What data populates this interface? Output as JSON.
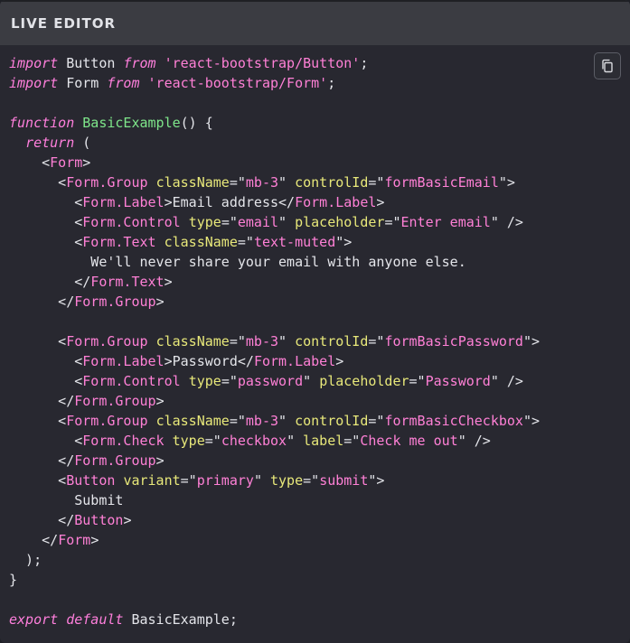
{
  "header": {
    "title": "LIVE EDITOR"
  },
  "toolbar": {
    "copy_icon": "copy-icon"
  },
  "colors": {
    "background": "#282830",
    "header_bg": "#3b3c42",
    "keyword": "#ff7fdc",
    "tag": "#ff80d6",
    "function_name": "#7ee68a",
    "attribute": "#e8e87a",
    "text": "#e4e5ea"
  },
  "code": {
    "lines": [
      [
        {
          "t": "import",
          "c": "k"
        },
        {
          "t": " Button ",
          "c": ""
        },
        {
          "t": "from",
          "c": "k"
        },
        {
          "t": " ",
          "c": ""
        },
        {
          "t": "'react-bootstrap/Button'",
          "c": "s"
        },
        {
          "t": ";",
          "c": ""
        }
      ],
      [
        {
          "t": "import",
          "c": "k"
        },
        {
          "t": " Form ",
          "c": ""
        },
        {
          "t": "from",
          "c": "k"
        },
        {
          "t": " ",
          "c": ""
        },
        {
          "t": "'react-bootstrap/Form'",
          "c": "s"
        },
        {
          "t": ";",
          "c": ""
        }
      ],
      [],
      [
        {
          "t": "function",
          "c": "k"
        },
        {
          "t": " ",
          "c": ""
        },
        {
          "t": "BasicExample",
          "c": "fn"
        },
        {
          "t": "() {",
          "c": ""
        }
      ],
      [
        {
          "t": "  ",
          "c": ""
        },
        {
          "t": "return",
          "c": "k"
        },
        {
          "t": " (",
          "c": ""
        }
      ],
      [
        {
          "t": "    <",
          "c": ""
        },
        {
          "t": "Form",
          "c": "t"
        },
        {
          "t": ">",
          "c": ""
        }
      ],
      [
        {
          "t": "      <",
          "c": ""
        },
        {
          "t": "Form.Group",
          "c": "t"
        },
        {
          "t": " ",
          "c": ""
        },
        {
          "t": "className",
          "c": "a"
        },
        {
          "t": "=\"",
          "c": ""
        },
        {
          "t": "mb-3",
          "c": "s"
        },
        {
          "t": "\" ",
          "c": ""
        },
        {
          "t": "controlId",
          "c": "a"
        },
        {
          "t": "=\"",
          "c": ""
        },
        {
          "t": "formBasicEmail",
          "c": "s"
        },
        {
          "t": "\">",
          "c": ""
        }
      ],
      [
        {
          "t": "        <",
          "c": ""
        },
        {
          "t": "Form.Label",
          "c": "t"
        },
        {
          "t": ">Email address</",
          "c": ""
        },
        {
          "t": "Form.Label",
          "c": "t"
        },
        {
          "t": ">",
          "c": ""
        }
      ],
      [
        {
          "t": "        <",
          "c": ""
        },
        {
          "t": "Form.Control",
          "c": "t"
        },
        {
          "t": " ",
          "c": ""
        },
        {
          "t": "type",
          "c": "a"
        },
        {
          "t": "=\"",
          "c": ""
        },
        {
          "t": "email",
          "c": "s"
        },
        {
          "t": "\" ",
          "c": ""
        },
        {
          "t": "placeholder",
          "c": "a"
        },
        {
          "t": "=\"",
          "c": ""
        },
        {
          "t": "Enter email",
          "c": "s"
        },
        {
          "t": "\" />",
          "c": ""
        }
      ],
      [
        {
          "t": "        <",
          "c": ""
        },
        {
          "t": "Form.Text",
          "c": "t"
        },
        {
          "t": " ",
          "c": ""
        },
        {
          "t": "className",
          "c": "a"
        },
        {
          "t": "=\"",
          "c": ""
        },
        {
          "t": "text-muted",
          "c": "s"
        },
        {
          "t": "\">",
          "c": ""
        }
      ],
      [
        {
          "t": "          We'll never share your email with anyone else.",
          "c": ""
        }
      ],
      [
        {
          "t": "        </",
          "c": ""
        },
        {
          "t": "Form.Text",
          "c": "t"
        },
        {
          "t": ">",
          "c": ""
        }
      ],
      [
        {
          "t": "      </",
          "c": ""
        },
        {
          "t": "Form.Group",
          "c": "t"
        },
        {
          "t": ">",
          "c": ""
        }
      ],
      [],
      [
        {
          "t": "      <",
          "c": ""
        },
        {
          "t": "Form.Group",
          "c": "t"
        },
        {
          "t": " ",
          "c": ""
        },
        {
          "t": "className",
          "c": "a"
        },
        {
          "t": "=\"",
          "c": ""
        },
        {
          "t": "mb-3",
          "c": "s"
        },
        {
          "t": "\" ",
          "c": ""
        },
        {
          "t": "controlId",
          "c": "a"
        },
        {
          "t": "=\"",
          "c": ""
        },
        {
          "t": "formBasicPassword",
          "c": "s"
        },
        {
          "t": "\">",
          "c": ""
        }
      ],
      [
        {
          "t": "        <",
          "c": ""
        },
        {
          "t": "Form.Label",
          "c": "t"
        },
        {
          "t": ">Password</",
          "c": ""
        },
        {
          "t": "Form.Label",
          "c": "t"
        },
        {
          "t": ">",
          "c": ""
        }
      ],
      [
        {
          "t": "        <",
          "c": ""
        },
        {
          "t": "Form.Control",
          "c": "t"
        },
        {
          "t": " ",
          "c": ""
        },
        {
          "t": "type",
          "c": "a"
        },
        {
          "t": "=\"",
          "c": ""
        },
        {
          "t": "password",
          "c": "s"
        },
        {
          "t": "\" ",
          "c": ""
        },
        {
          "t": "placeholder",
          "c": "a"
        },
        {
          "t": "=\"",
          "c": ""
        },
        {
          "t": "Password",
          "c": "s"
        },
        {
          "t": "\" />",
          "c": ""
        }
      ],
      [
        {
          "t": "      </",
          "c": ""
        },
        {
          "t": "Form.Group",
          "c": "t"
        },
        {
          "t": ">",
          "c": ""
        }
      ],
      [
        {
          "t": "      <",
          "c": ""
        },
        {
          "t": "Form.Group",
          "c": "t"
        },
        {
          "t": " ",
          "c": ""
        },
        {
          "t": "className",
          "c": "a"
        },
        {
          "t": "=\"",
          "c": ""
        },
        {
          "t": "mb-3",
          "c": "s"
        },
        {
          "t": "\" ",
          "c": ""
        },
        {
          "t": "controlId",
          "c": "a"
        },
        {
          "t": "=\"",
          "c": ""
        },
        {
          "t": "formBasicCheckbox",
          "c": "s"
        },
        {
          "t": "\">",
          "c": ""
        }
      ],
      [
        {
          "t": "        <",
          "c": ""
        },
        {
          "t": "Form.Check",
          "c": "t"
        },
        {
          "t": " ",
          "c": ""
        },
        {
          "t": "type",
          "c": "a"
        },
        {
          "t": "=\"",
          "c": ""
        },
        {
          "t": "checkbox",
          "c": "s"
        },
        {
          "t": "\" ",
          "c": ""
        },
        {
          "t": "label",
          "c": "a"
        },
        {
          "t": "=\"",
          "c": ""
        },
        {
          "t": "Check me out",
          "c": "s"
        },
        {
          "t": "\" />",
          "c": ""
        }
      ],
      [
        {
          "t": "      </",
          "c": ""
        },
        {
          "t": "Form.Group",
          "c": "t"
        },
        {
          "t": ">",
          "c": ""
        }
      ],
      [
        {
          "t": "      <",
          "c": ""
        },
        {
          "t": "Button",
          "c": "t"
        },
        {
          "t": " ",
          "c": ""
        },
        {
          "t": "variant",
          "c": "a"
        },
        {
          "t": "=\"",
          "c": ""
        },
        {
          "t": "primary",
          "c": "s"
        },
        {
          "t": "\" ",
          "c": ""
        },
        {
          "t": "type",
          "c": "a"
        },
        {
          "t": "=\"",
          "c": ""
        },
        {
          "t": "submit",
          "c": "s"
        },
        {
          "t": "\">",
          "c": ""
        }
      ],
      [
        {
          "t": "        Submit",
          "c": ""
        }
      ],
      [
        {
          "t": "      </",
          "c": ""
        },
        {
          "t": "Button",
          "c": "t"
        },
        {
          "t": ">",
          "c": ""
        }
      ],
      [
        {
          "t": "    </",
          "c": ""
        },
        {
          "t": "Form",
          "c": "t"
        },
        {
          "t": ">",
          "c": ""
        }
      ],
      [
        {
          "t": "  );",
          "c": ""
        }
      ],
      [
        {
          "t": "}",
          "c": ""
        }
      ],
      [],
      [
        {
          "t": "export",
          "c": "k"
        },
        {
          "t": " ",
          "c": ""
        },
        {
          "t": "default",
          "c": "k"
        },
        {
          "t": " BasicExample;",
          "c": ""
        }
      ]
    ]
  }
}
